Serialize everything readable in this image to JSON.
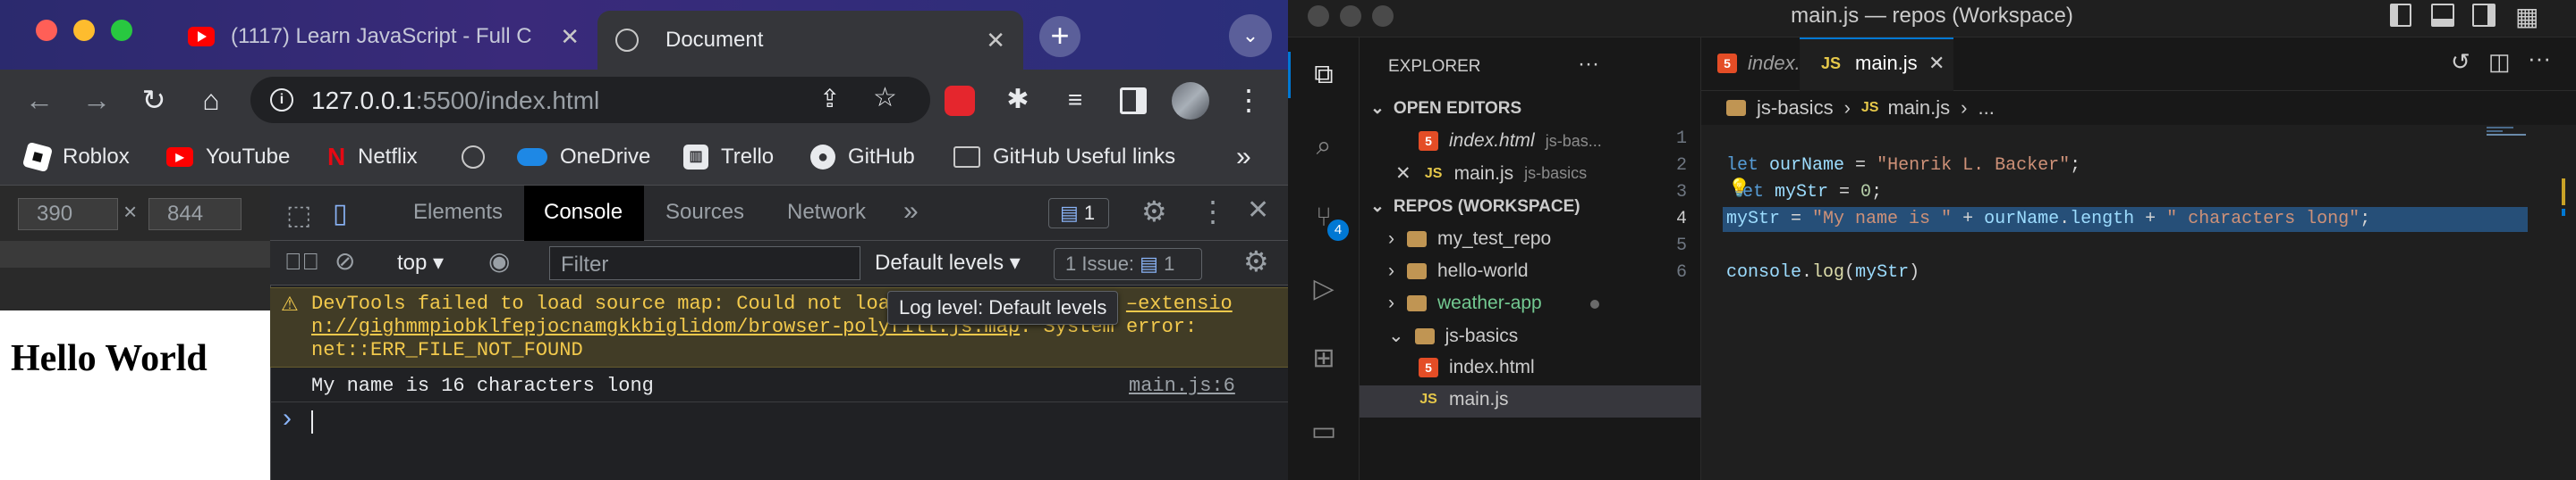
{
  "browser": {
    "tabs": [
      {
        "title": "(1117) Learn JavaScript - Full C"
      },
      {
        "title": "Document"
      }
    ],
    "url": {
      "host": "127.0.0.1",
      "rest": ":5500/index.html"
    },
    "bookmarks": [
      "Roblox",
      "YouTube",
      "Netflix",
      "OneDrive",
      "Trello",
      "GitHub",
      "GitHub Useful links"
    ],
    "more_bookmarks": "»",
    "viewport": {
      "width": "390",
      "height": "844",
      "x": "×"
    },
    "page_heading": "Hello World",
    "devtools": {
      "tabs": [
        "Elements",
        "Console",
        "Sources",
        "Network"
      ],
      "active_tab": "Console",
      "more": "»",
      "message_count": "1",
      "context": "top",
      "filter_placeholder": "Filter",
      "levels": "Default levels",
      "issues": "1 Issue:",
      "issues_count": "1",
      "warning_line1": "DevTools failed to load source map: Could not loa",
      "warning_line1b": "–extensio",
      "warning_line2a": "n://gighmmpiobklfepjocnamgkkbiglidom/browser-polyfill.js.map",
      "warning_line2b": ": System error:",
      "warning_line3": "net::ERR_FILE_NOT_FOUND",
      "tooltip": "Log level: Default levels",
      "log_message": "My name is 16 characters long",
      "log_source": "main.js:6",
      "prompt": "›"
    }
  },
  "vscode": {
    "title": "main.js — repos (Workspace)",
    "explorer_title": "EXPLORER",
    "explorer_more": "···",
    "open_editors_label": "OPEN EDITORS",
    "open_editors": [
      {
        "name": "index.html",
        "detail": "js-bas..."
      },
      {
        "name": "main.js",
        "detail": "js-basics"
      }
    ],
    "workspace_label": "REPOS (WORKSPACE)",
    "folders": [
      "my_test_repo",
      "hello-world",
      "weather-app",
      "js-basics"
    ],
    "files": [
      "index.html",
      "main.js"
    ],
    "source_control_badge": "4",
    "editor_tabs": [
      {
        "name": "index.html"
      },
      {
        "name": "main.js"
      }
    ],
    "breadcrumb": [
      "js-basics",
      "main.js",
      "..."
    ],
    "line_numbers": [
      "1",
      "2",
      "3",
      "4",
      "5",
      "6"
    ],
    "code": {
      "l2": [
        {
          "t": "let",
          "c": "kw"
        },
        {
          "t": " ourName ",
          "c": "var"
        },
        {
          "t": "=",
          "c": "op"
        },
        {
          "t": " \"Henrik L. Backer\"",
          "c": "str"
        },
        {
          "t": ";",
          "c": "op"
        }
      ],
      "l3": [
        {
          "t": "et",
          "c": "kw"
        },
        {
          "t": " myStr ",
          "c": "var"
        },
        {
          "t": "=",
          "c": "op"
        },
        {
          "t": " 0",
          "c": "num"
        },
        {
          "t": ";",
          "c": "op"
        }
      ],
      "l4": [
        {
          "t": "myStr",
          "c": "var"
        },
        {
          "t": " = ",
          "c": "op"
        },
        {
          "t": "\"My name is \"",
          "c": "str"
        },
        {
          "t": " + ",
          "c": "op"
        },
        {
          "t": "ourName",
          "c": "var"
        },
        {
          "t": ".",
          "c": "op"
        },
        {
          "t": "length",
          "c": "var"
        },
        {
          "t": " + ",
          "c": "op"
        },
        {
          "t": "\" characters long\"",
          "c": "str"
        },
        {
          "t": ";",
          "c": "op"
        }
      ],
      "l6": [
        {
          "t": "console",
          "c": "var"
        },
        {
          "t": ".",
          "c": "op"
        },
        {
          "t": "log",
          "c": "fn"
        },
        {
          "t": "(",
          "c": "op"
        },
        {
          "t": "myStr",
          "c": "var"
        },
        {
          "t": ")",
          "c": "op"
        }
      ]
    },
    "colors": {
      "kw": "#569cd6",
      "var": "#9cdcfe",
      "op": "#d4d4d4",
      "str": "#ce9178",
      "num": "#b5cea8",
      "fn": "#dcdcaa"
    }
  }
}
